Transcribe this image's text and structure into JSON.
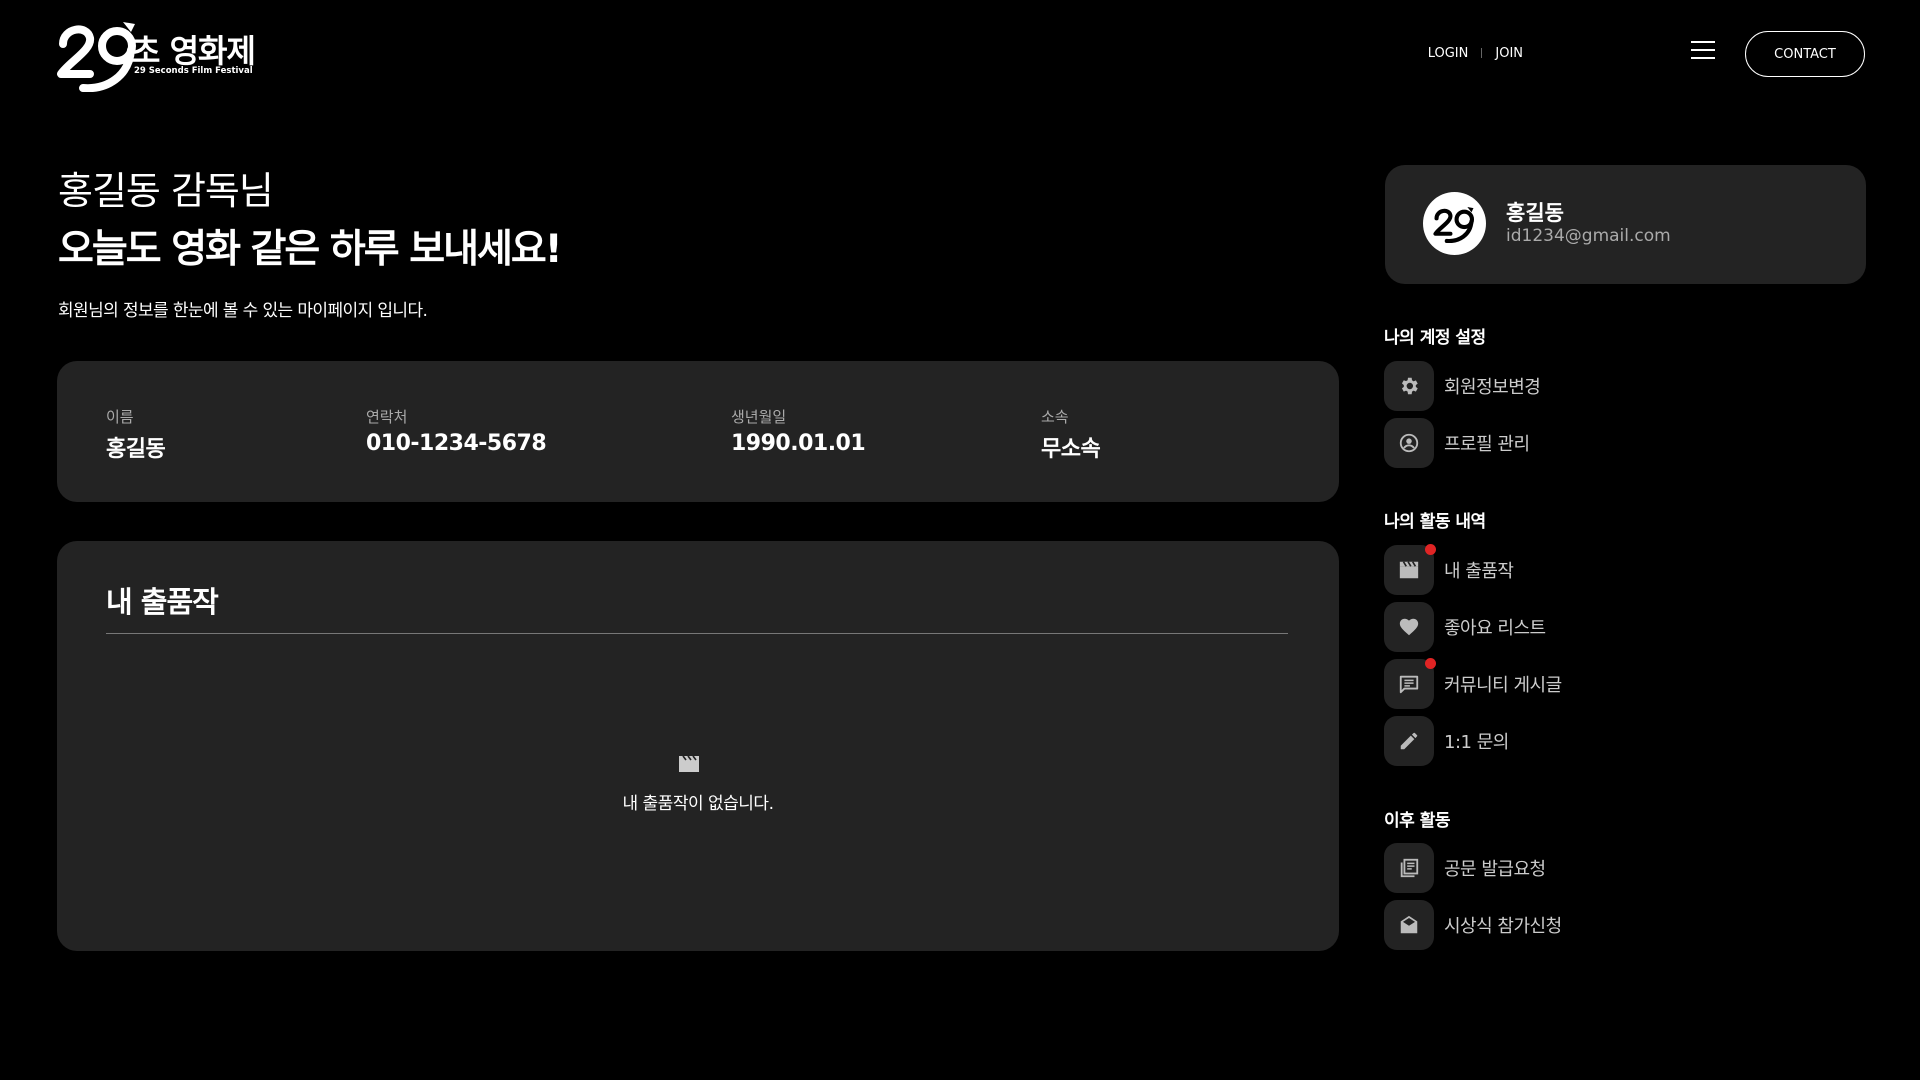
{
  "header": {
    "logo_number": "29",
    "logo_title": "초 영화제",
    "logo_subtitle": "29 Seconds Film Festival",
    "login_label": "LOGIN",
    "join_label": "JOIN",
    "contact_label": "CONTACT"
  },
  "greeting": {
    "name_line": "홍길동 감독님",
    "message": "오늘도 영화 같은 하루 보내세요!",
    "subtitle": "회원님의 정보를 한눈에 볼 수 있는 마이페이지 입니다."
  },
  "info": {
    "name": {
      "label": "이름",
      "value": "홍길동"
    },
    "phone": {
      "label": "연락처",
      "value": "010-1234-5678"
    },
    "birth": {
      "label": "생년월일",
      "value": "1990.01.01"
    },
    "affiliation": {
      "label": "소속",
      "value": "무소속"
    }
  },
  "works": {
    "title": "내 출품작",
    "empty_text": "내 출품작이 없습니다."
  },
  "profile": {
    "name": "홍길동",
    "email": "id1234@gmail.com"
  },
  "sidebar": {
    "account": {
      "title": "나의 계정 설정",
      "items": [
        {
          "label": "회원정보변경",
          "icon": "gear-icon"
        },
        {
          "label": "프로필 관리",
          "icon": "profile-icon"
        }
      ]
    },
    "activity": {
      "title": "나의 활동 내역",
      "items": [
        {
          "label": "내 출품작",
          "icon": "clapperboard-icon",
          "has_notification": true
        },
        {
          "label": "좋아요 리스트",
          "icon": "heart-icon",
          "has_notification": false
        },
        {
          "label": "커뮤니티 게시글",
          "icon": "comment-icon",
          "has_notification": true
        },
        {
          "label": "1:1 문의",
          "icon": "pencil-icon",
          "has_notification": false
        }
      ]
    },
    "after": {
      "title": "이후 활동",
      "items": [
        {
          "label": "공문 발급요청",
          "icon": "document-icon"
        },
        {
          "label": "시상식 참가신청",
          "icon": "envelope-icon"
        }
      ]
    }
  },
  "colors": {
    "background": "#000000",
    "card": "#232323",
    "notification": "#e02424",
    "muted_text": "#aaaaaa"
  }
}
